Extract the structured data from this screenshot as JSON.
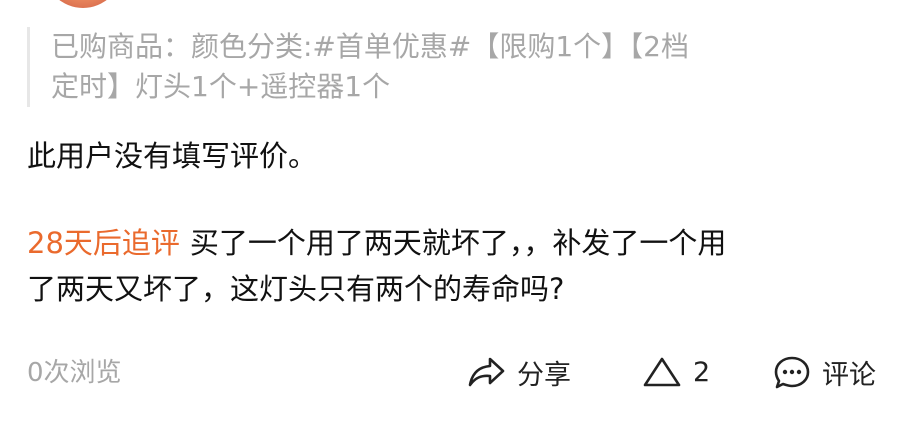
{
  "purchase": {
    "line1": "已购商品：颜色分类:#首单优惠#【限购1个】【2档",
    "line2": "定时】灯头1个+遥控器1个"
  },
  "review": {
    "text": "此用户没有填写评价。"
  },
  "followup": {
    "tag": "28天后追评",
    "line1": "买了一个用了两天就坏了，，补发了一个用",
    "line2": "了两天又坏了，这灯头只有两个的寿命吗?"
  },
  "footer": {
    "views": "0次浏览",
    "share_label": "分享",
    "like_count": "2",
    "comment_label": "评论"
  },
  "icons": {
    "share": "share-arrow-icon",
    "like": "triangle-up-icon",
    "comment": "speech-bubble-icon"
  },
  "colors": {
    "accent": "#ea6a2d",
    "muted": "#a7a7a7",
    "text": "#111111"
  }
}
